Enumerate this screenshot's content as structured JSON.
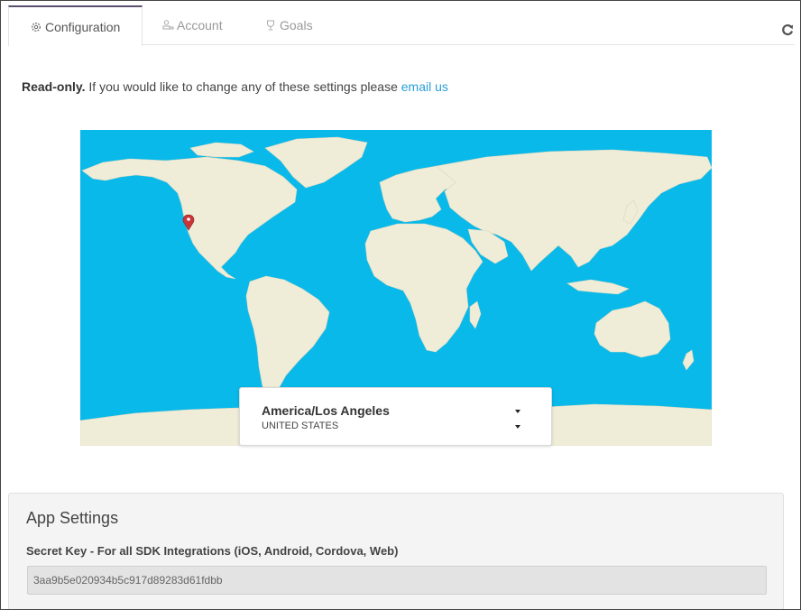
{
  "tabs": [
    {
      "label": "Configuration",
      "icon": "gear-icon",
      "active": true
    },
    {
      "label": "Account",
      "icon": "account-icon",
      "active": false
    },
    {
      "label": "Goals",
      "icon": "trophy-icon",
      "active": false
    }
  ],
  "toolbar": {
    "refresh_icon": "refresh-icon"
  },
  "notice": {
    "bold": "Read-only.",
    "text": " If you would like to change any of these settings please ",
    "link": "email us"
  },
  "map": {
    "ocean_color": "#08b9ea",
    "land_color": "#efedd8",
    "pin_color": "#c8363a",
    "timezone": "America/Los Angeles",
    "country": "UNITED STATES"
  },
  "app_settings": {
    "title": "App Settings",
    "secret_key_label": "Secret Key - For all SDK Integrations (iOS, Android, Cordova, Web)",
    "secret_key_value": "3aa9b5e020934b5c917d89283d61fdbb"
  }
}
